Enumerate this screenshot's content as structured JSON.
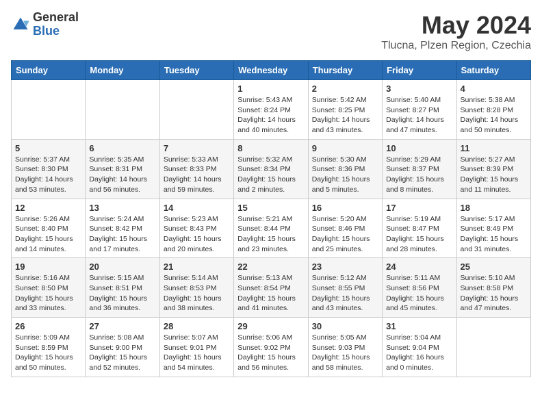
{
  "header": {
    "logo": {
      "general": "General",
      "blue": "Blue"
    },
    "title": "May 2024",
    "location": "Tlucna, Plzen Region, Czechia"
  },
  "days_of_week": [
    "Sunday",
    "Monday",
    "Tuesday",
    "Wednesday",
    "Thursday",
    "Friday",
    "Saturday"
  ],
  "weeks": [
    {
      "days": [
        {
          "number": "",
          "content": ""
        },
        {
          "number": "",
          "content": ""
        },
        {
          "number": "",
          "content": ""
        },
        {
          "number": "1",
          "content": "Sunrise: 5:43 AM\nSunset: 8:24 PM\nDaylight: 14 hours\nand 40 minutes."
        },
        {
          "number": "2",
          "content": "Sunrise: 5:42 AM\nSunset: 8:25 PM\nDaylight: 14 hours\nand 43 minutes."
        },
        {
          "number": "3",
          "content": "Sunrise: 5:40 AM\nSunset: 8:27 PM\nDaylight: 14 hours\nand 47 minutes."
        },
        {
          "number": "4",
          "content": "Sunrise: 5:38 AM\nSunset: 8:28 PM\nDaylight: 14 hours\nand 50 minutes."
        }
      ]
    },
    {
      "days": [
        {
          "number": "5",
          "content": "Sunrise: 5:37 AM\nSunset: 8:30 PM\nDaylight: 14 hours\nand 53 minutes."
        },
        {
          "number": "6",
          "content": "Sunrise: 5:35 AM\nSunset: 8:31 PM\nDaylight: 14 hours\nand 56 minutes."
        },
        {
          "number": "7",
          "content": "Sunrise: 5:33 AM\nSunset: 8:33 PM\nDaylight: 14 hours\nand 59 minutes."
        },
        {
          "number": "8",
          "content": "Sunrise: 5:32 AM\nSunset: 8:34 PM\nDaylight: 15 hours\nand 2 minutes."
        },
        {
          "number": "9",
          "content": "Sunrise: 5:30 AM\nSunset: 8:36 PM\nDaylight: 15 hours\nand 5 minutes."
        },
        {
          "number": "10",
          "content": "Sunrise: 5:29 AM\nSunset: 8:37 PM\nDaylight: 15 hours\nand 8 minutes."
        },
        {
          "number": "11",
          "content": "Sunrise: 5:27 AM\nSunset: 8:39 PM\nDaylight: 15 hours\nand 11 minutes."
        }
      ]
    },
    {
      "days": [
        {
          "number": "12",
          "content": "Sunrise: 5:26 AM\nSunset: 8:40 PM\nDaylight: 15 hours\nand 14 minutes."
        },
        {
          "number": "13",
          "content": "Sunrise: 5:24 AM\nSunset: 8:42 PM\nDaylight: 15 hours\nand 17 minutes."
        },
        {
          "number": "14",
          "content": "Sunrise: 5:23 AM\nSunset: 8:43 PM\nDaylight: 15 hours\nand 20 minutes."
        },
        {
          "number": "15",
          "content": "Sunrise: 5:21 AM\nSunset: 8:44 PM\nDaylight: 15 hours\nand 23 minutes."
        },
        {
          "number": "16",
          "content": "Sunrise: 5:20 AM\nSunset: 8:46 PM\nDaylight: 15 hours\nand 25 minutes."
        },
        {
          "number": "17",
          "content": "Sunrise: 5:19 AM\nSunset: 8:47 PM\nDaylight: 15 hours\nand 28 minutes."
        },
        {
          "number": "18",
          "content": "Sunrise: 5:17 AM\nSunset: 8:49 PM\nDaylight: 15 hours\nand 31 minutes."
        }
      ]
    },
    {
      "days": [
        {
          "number": "19",
          "content": "Sunrise: 5:16 AM\nSunset: 8:50 PM\nDaylight: 15 hours\nand 33 minutes."
        },
        {
          "number": "20",
          "content": "Sunrise: 5:15 AM\nSunset: 8:51 PM\nDaylight: 15 hours\nand 36 minutes."
        },
        {
          "number": "21",
          "content": "Sunrise: 5:14 AM\nSunset: 8:53 PM\nDaylight: 15 hours\nand 38 minutes."
        },
        {
          "number": "22",
          "content": "Sunrise: 5:13 AM\nSunset: 8:54 PM\nDaylight: 15 hours\nand 41 minutes."
        },
        {
          "number": "23",
          "content": "Sunrise: 5:12 AM\nSunset: 8:55 PM\nDaylight: 15 hours\nand 43 minutes."
        },
        {
          "number": "24",
          "content": "Sunrise: 5:11 AM\nSunset: 8:56 PM\nDaylight: 15 hours\nand 45 minutes."
        },
        {
          "number": "25",
          "content": "Sunrise: 5:10 AM\nSunset: 8:58 PM\nDaylight: 15 hours\nand 47 minutes."
        }
      ]
    },
    {
      "days": [
        {
          "number": "26",
          "content": "Sunrise: 5:09 AM\nSunset: 8:59 PM\nDaylight: 15 hours\nand 50 minutes."
        },
        {
          "number": "27",
          "content": "Sunrise: 5:08 AM\nSunset: 9:00 PM\nDaylight: 15 hours\nand 52 minutes."
        },
        {
          "number": "28",
          "content": "Sunrise: 5:07 AM\nSunset: 9:01 PM\nDaylight: 15 hours\nand 54 minutes."
        },
        {
          "number": "29",
          "content": "Sunrise: 5:06 AM\nSunset: 9:02 PM\nDaylight: 15 hours\nand 56 minutes."
        },
        {
          "number": "30",
          "content": "Sunrise: 5:05 AM\nSunset: 9:03 PM\nDaylight: 15 hours\nand 58 minutes."
        },
        {
          "number": "31",
          "content": "Sunrise: 5:04 AM\nSunset: 9:04 PM\nDaylight: 16 hours\nand 0 minutes."
        },
        {
          "number": "",
          "content": ""
        }
      ]
    }
  ]
}
